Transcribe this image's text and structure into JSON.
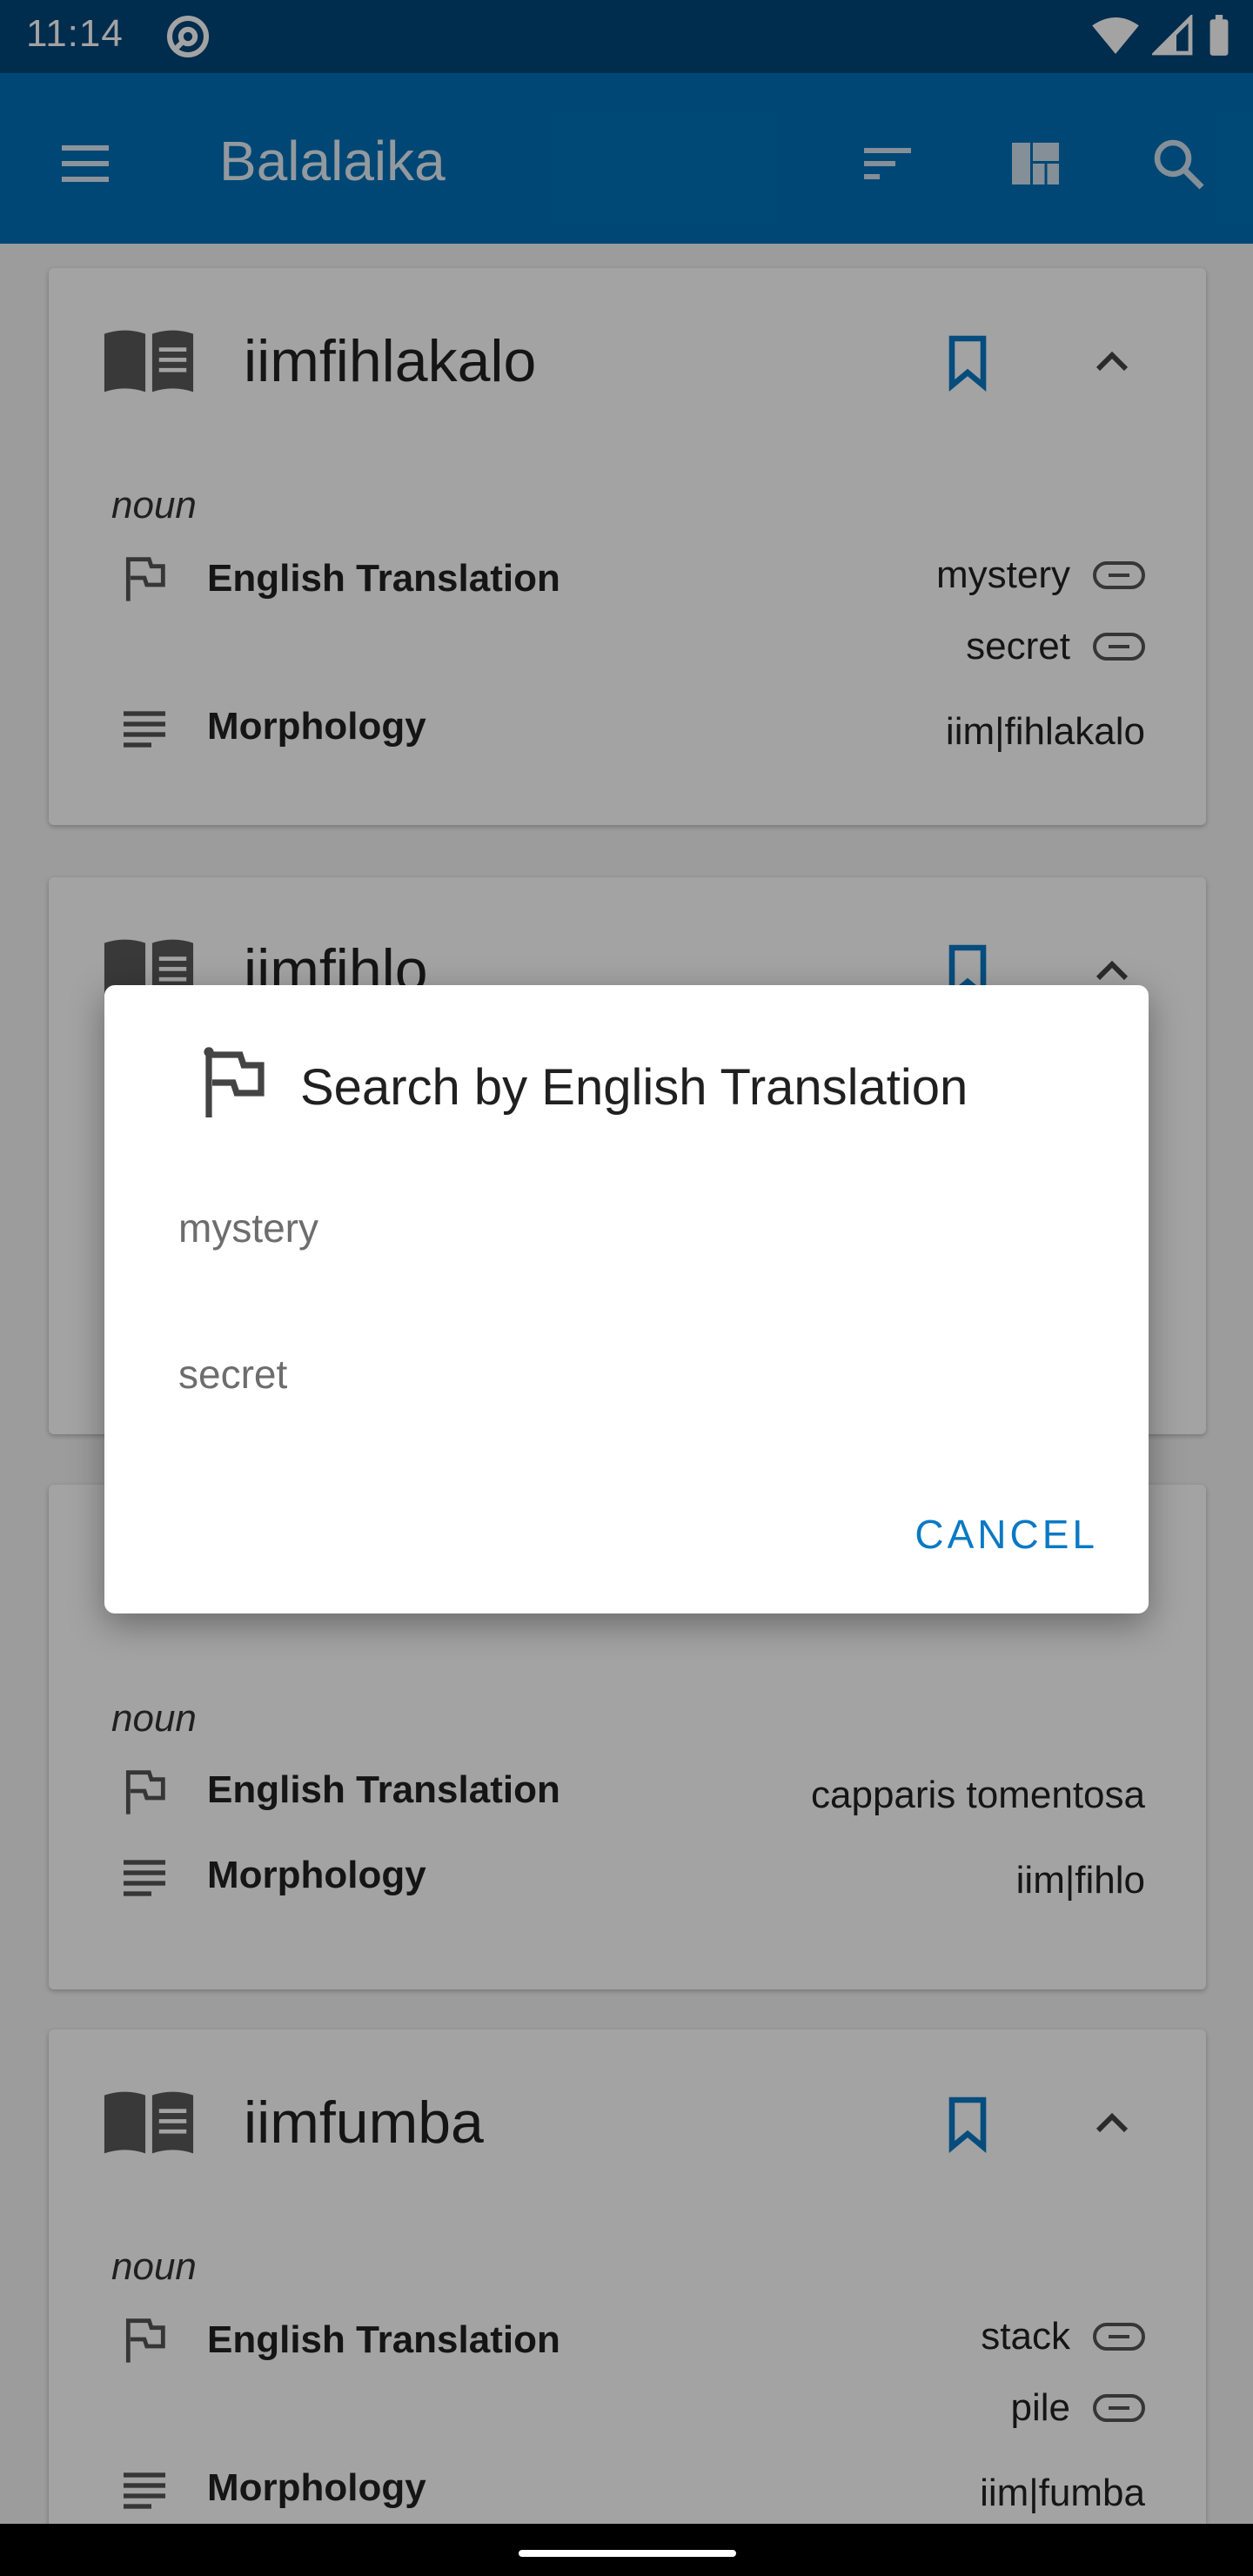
{
  "status_bar": {
    "time": "11:14"
  },
  "app_bar": {
    "title": "Balalaika"
  },
  "entries": [
    {
      "word": "iimfihlakalo",
      "pos": "noun",
      "translation_label": "English Translation",
      "translations": [
        "mystery",
        "secret"
      ],
      "morphology_label": "Morphology",
      "morphology": "iim|fihlakalo"
    },
    {
      "word": "iimfihlo",
      "pos": "noun",
      "translation_label": "English Translation",
      "translations": [
        "capparis tomentosa"
      ],
      "morphology_label": "Morphology",
      "morphology": "iim|fihlo"
    },
    {
      "word": "iimfumba",
      "pos": "noun",
      "translation_label": "English Translation",
      "translations": [
        "stack",
        "pile"
      ],
      "morphology_label": "Morphology",
      "morphology": "iim|fumba"
    }
  ],
  "dialog": {
    "title": "Search by English Translation",
    "options": [
      "mystery",
      "secret"
    ],
    "cancel_label": "CANCEL"
  },
  "colors": {
    "status_bar": "#00467a",
    "app_bar": "#0070b8",
    "accent": "#0a79c4",
    "bookmark": "#0a79c4"
  }
}
